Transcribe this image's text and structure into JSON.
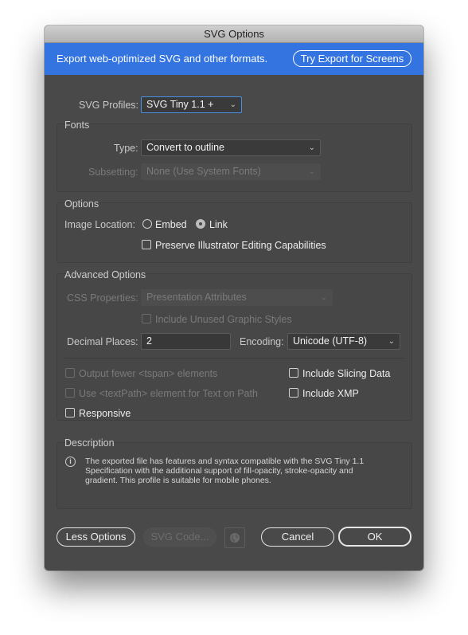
{
  "window": {
    "title": "SVG Options"
  },
  "banner": {
    "text": "Export web-optimized SVG and other formats.",
    "button_label": "Try Export for Screens",
    "color": "#3374e0"
  },
  "svg_profiles": {
    "label": "SVG Profiles:",
    "value": "SVG Tiny 1.1 +"
  },
  "fonts": {
    "title": "Fonts",
    "type_label": "Type:",
    "type_value": "Convert to outline",
    "subsetting_label": "Subsetting:",
    "subsetting_value": "None (Use System Fonts)"
  },
  "options": {
    "title": "Options",
    "image_location_label": "Image Location:",
    "embed_label": "Embed",
    "link_label": "Link",
    "selected": "Link",
    "preserve_label": "Preserve Illustrator Editing Capabilities",
    "preserve_checked": false
  },
  "advanced": {
    "title": "Advanced Options",
    "css_label": "CSS Properties:",
    "css_value": "Presentation Attributes",
    "unused_styles_label": "Include Unused Graphic Styles",
    "decimal_label": "Decimal Places:",
    "decimal_value": "2",
    "encoding_label": "Encoding:",
    "encoding_value": "Unicode (UTF-8)",
    "tspan_label": "Output fewer <tspan> elements",
    "textpath_label": "Use <textPath> element for Text on Path",
    "responsive_label": "Responsive",
    "slicing_label": "Include Slicing Data",
    "xmp_label": "Include XMP"
  },
  "description": {
    "title": "Description",
    "line1": "The exported file has features and syntax compatible with the SVG Tiny 1.1",
    "line2": "Specification with the additional support of fill-opacity, stroke-opacity and",
    "line3": "gradient. This profile is suitable for mobile phones.",
    "info_glyph": "i"
  },
  "footer": {
    "less_options": "Less Options",
    "svg_code": "SVG Code...",
    "cancel": "Cancel",
    "ok": "OK",
    "globe_icon": "globe-icon"
  },
  "icons": {
    "chevron": "⌄"
  }
}
